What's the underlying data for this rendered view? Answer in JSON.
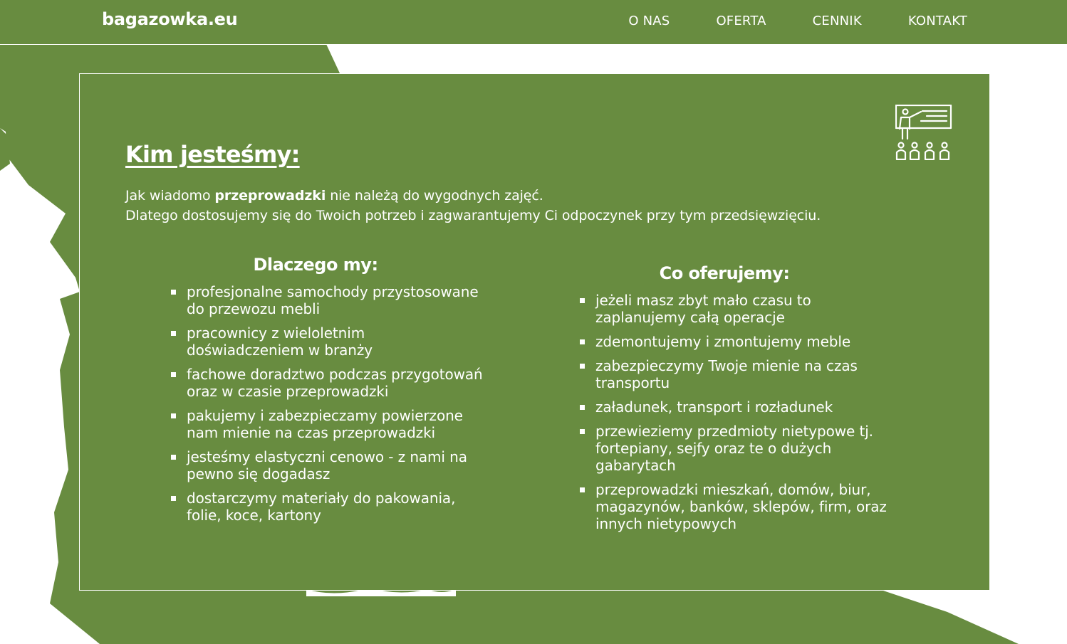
{
  "header": {
    "logo": "bagazowka.eu",
    "nav": [
      {
        "label": "O NAS"
      },
      {
        "label": "OFERTA"
      },
      {
        "label": "CENNIK"
      },
      {
        "label": "KONTAKT"
      }
    ]
  },
  "about": {
    "icon": "presentation-teacher-icon",
    "title": "Kim jesteśmy:",
    "intro_line1_before": "Jak wiadomo ",
    "intro_line1_bold": "przeprowadzki",
    "intro_line1_after": " nie należą do wygodnych zajęć.",
    "intro_line2": "Dlatego dostosujemy się do Twoich potrzeb i zagwarantujemy Ci odpoczynek przy tym przedsięwzięciu.",
    "why": {
      "heading": "Dlaczego my:",
      "items": [
        "profesjonalne samochody przystosowane do przewozu mebli",
        "pracownicy z wieloletnim doświadczeniem w branży",
        "fachowe doradztwo podczas przygotowań oraz w czasie przeprowadzki",
        "pakujemy i zabezpieczamy powierzone nam mienie na czas przeprowadzki",
        "jesteśmy elastyczni cenowo - z nami na pewno się dogadasz",
        "dostarczymy materiały do pakowania, folie, koce, kartony"
      ]
    },
    "offer": {
      "heading": "Co oferujemy:",
      "items": [
        "jeżeli masz zbyt mało czasu to zaplanujemy całą operacje",
        "zdemontujemy i zmontujemy meble",
        "zabezpieczymy Twoje mienie na czas transportu",
        "załadunek, transport i rozładunek",
        "przewieziemy przedmioty nietypowe tj. fortepiany, sejfy oraz te o dużych gabarytach",
        "przeprowadzki mieszkań, domów, biur, magazynów, banków, sklepów, firm, oraz innych nietypowych"
      ]
    }
  },
  "colors": {
    "brand_green": "#688c40",
    "text": "#ffffff",
    "background": "#ffffff"
  }
}
